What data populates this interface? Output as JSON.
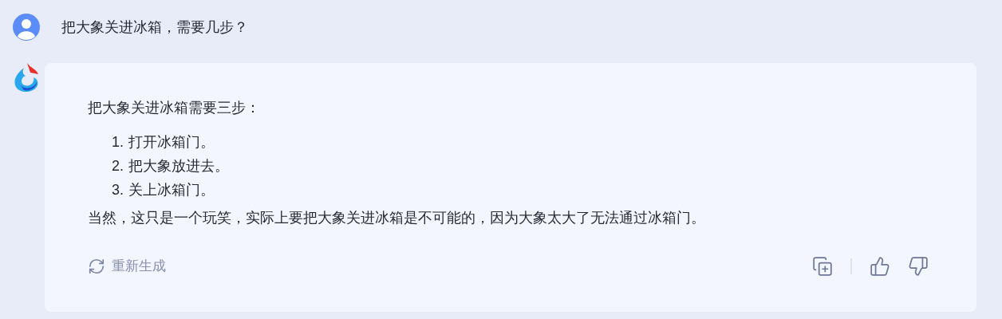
{
  "question": {
    "text": "把大象关进冰箱，需要几步？"
  },
  "answer": {
    "intro": "把大象关进冰箱需要三步：",
    "steps": [
      {
        "number": "1.",
        "text": "打开冰箱门。"
      },
      {
        "number": "2.",
        "text": "把大象放进去。"
      },
      {
        "number": "3.",
        "text": "关上冰箱门。"
      }
    ],
    "conclusion": "当然，这只是一个玩笑，实际上要把大象关进冰箱是不可能的，因为大象太大了无法通过冰箱门。"
  },
  "actions": {
    "regenerate": "重新生成"
  }
}
